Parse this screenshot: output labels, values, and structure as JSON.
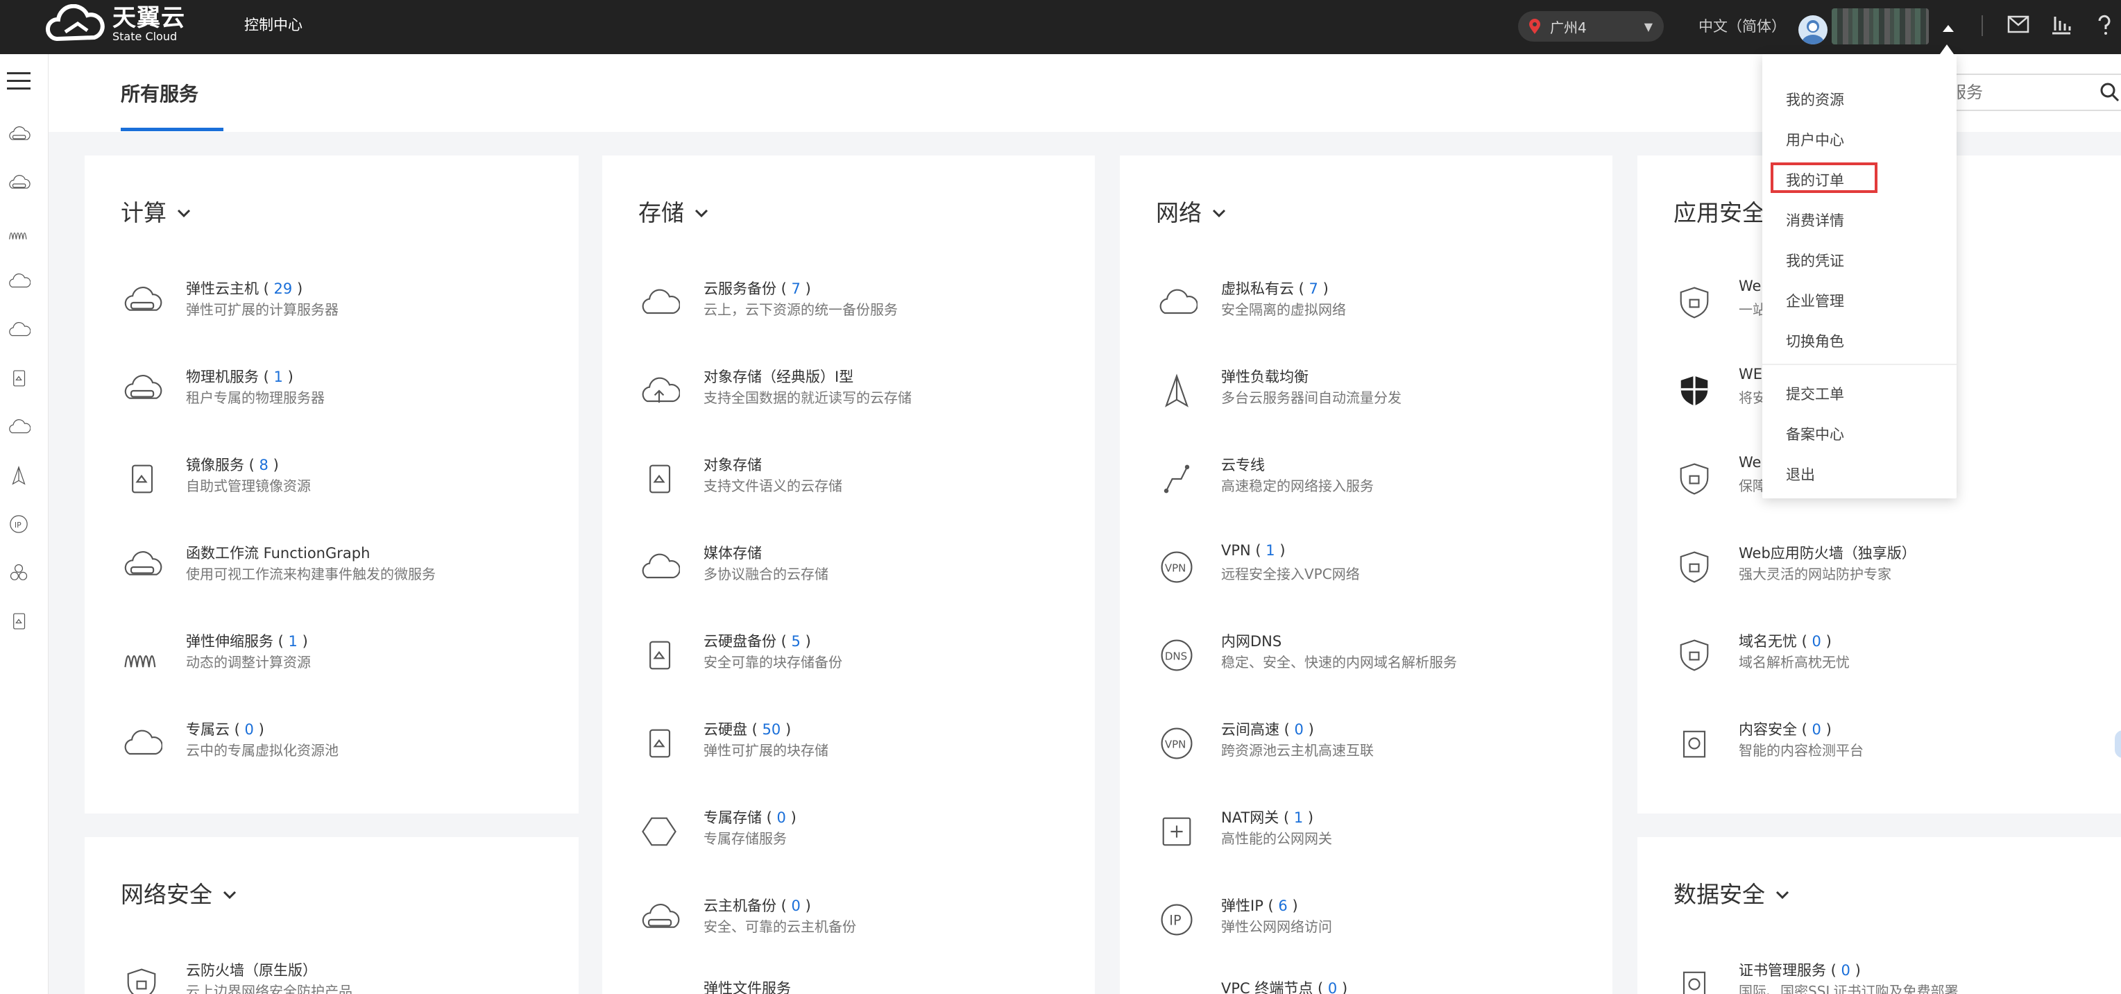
{
  "topbar": {
    "logo_cn": "天翼云",
    "logo_en": "State Cloud",
    "console": "控制中心",
    "region": "广州4",
    "language": "中文（简体）"
  },
  "tabs": {
    "active": "所有服务",
    "search_placeholder": "请输入服务名称搜索服务"
  },
  "user_menu": {
    "items": [
      "我的资源",
      "用户中心",
      "我的订单",
      "消费详情",
      "我的凭证",
      "企业管理",
      "切换角色",
      "提交工单",
      "备案中心",
      "退出"
    ],
    "highlighted": "我的订单"
  },
  "categories": [
    {
      "title": "计算",
      "services": [
        {
          "name": "弹性云主机",
          "count": "29",
          "desc": "弹性可扩展的计算服务器",
          "icon": "cloud-server-icon"
        },
        {
          "name": "物理机服务",
          "count": "1",
          "desc": "租户专属的物理服务器",
          "icon": "physical-server-icon"
        },
        {
          "name": "镜像服务",
          "count": "8",
          "desc": "自助式管理镜像资源",
          "icon": "image-icon"
        },
        {
          "name": "函数工作流 FunctionGraph",
          "count": "",
          "desc": "使用可视工作流来构建事件触发的微服务",
          "icon": "function-icon"
        },
        {
          "name": "弹性伸缩服务",
          "count": "1",
          "desc": "动态的调整计算资源",
          "icon": "autoscaling-icon"
        },
        {
          "name": "专属云",
          "count": "0",
          "desc": "云中的专属虚拟化资源池",
          "icon": "dedicated-cloud-icon"
        }
      ]
    },
    {
      "title": "存储",
      "services": [
        {
          "name": "云服务备份",
          "count": "7",
          "desc": "云上，云下资源的统一备份服务",
          "icon": "backup-cloud-icon"
        },
        {
          "name": "对象存储（经典版）Ⅰ型",
          "count": "",
          "desc": "支持全国数据的就近读写的云存储",
          "icon": "object-storage-icon"
        },
        {
          "name": "对象存储",
          "count": "",
          "desc": "支持文件语义的云存储",
          "icon": "file-storage-icon"
        },
        {
          "name": "媒体存储",
          "count": "",
          "desc": "多协议融合的云存储",
          "icon": "media-storage-icon"
        },
        {
          "name": "云硬盘备份",
          "count": "5",
          "desc": "安全可靠的块存储备份",
          "icon": "disk-backup-icon"
        },
        {
          "name": "云硬盘",
          "count": "50",
          "desc": "弹性可扩展的块存储",
          "icon": "disk-icon"
        },
        {
          "name": "专属存储",
          "count": "0",
          "desc": "专属存储服务",
          "icon": "dedicated-storage-icon"
        },
        {
          "name": "云主机备份",
          "count": "0",
          "desc": "安全、可靠的云主机备份",
          "icon": "host-backup-icon"
        },
        {
          "name": "弹性文件服务",
          "count": "",
          "desc": "",
          "icon": "elastic-file-icon"
        }
      ]
    },
    {
      "title": "网络",
      "services": [
        {
          "name": "虚拟私有云",
          "count": "7",
          "desc": "安全隔离的虚拟网络",
          "icon": "vpc-icon"
        },
        {
          "name": "弹性负载均衡",
          "count": "",
          "desc": "多台云服务器间自动流量分发",
          "icon": "load-balancer-icon"
        },
        {
          "name": "云专线",
          "count": "",
          "desc": "高速稳定的网络接入服务",
          "icon": "direct-connect-icon"
        },
        {
          "name": "VPN",
          "count": "1",
          "desc": "远程安全接入VPC网络",
          "icon": "vpn-icon"
        },
        {
          "name": "内网DNS",
          "count": "",
          "desc": "稳定、安全、快速的内网域名解析服务",
          "icon": "dns-icon"
        },
        {
          "name": "云间高速",
          "count": "0",
          "desc": "跨资源池云主机高速互联",
          "icon": "vpn-icon"
        },
        {
          "name": "NAT网关",
          "count": "1",
          "desc": "高性能的公网网关",
          "icon": "nat-icon"
        },
        {
          "name": "弹性IP",
          "count": "6",
          "desc": "弹性公网网络访问",
          "icon": "ip-icon"
        },
        {
          "name": "VPC 终端节点",
          "count": "0",
          "desc": "",
          "icon": "endpoint-icon"
        }
      ]
    },
    {
      "title": "应用安全",
      "services": [
        {
          "name": "Web",
          "count": "",
          "desc": "一站",
          "icon": "shield-icon"
        },
        {
          "name": "WEB",
          "count": "",
          "desc": "将安",
          "icon": "shield-black-icon"
        },
        {
          "name": "Web",
          "count": "",
          "desc": "保障",
          "icon": "shield-icon"
        },
        {
          "name": "Web应用防火墙（独享版）",
          "count": "",
          "desc": "强大灵活的网站防护专家",
          "icon": "shield-icon"
        },
        {
          "name": "域名无忧",
          "count": "0",
          "desc": "域名解析高枕无忧",
          "icon": "domain-icon"
        },
        {
          "name": "内容安全",
          "count": "0",
          "desc": "智能的内容检测平台",
          "icon": "content-security-icon"
        }
      ]
    },
    {
      "title": "网络安全",
      "services": [
        {
          "name": "云防火墙（原生版）",
          "count": "",
          "desc": "云上边界网络安全防护产品",
          "icon": "firewall-icon"
        }
      ]
    },
    {
      "title": "数据安全",
      "services": [
        {
          "name": "证书管理服务",
          "count": "0",
          "desc": "国际、国密SSL证书订购及免费部署",
          "icon": "certificate-icon"
        }
      ]
    }
  ]
}
